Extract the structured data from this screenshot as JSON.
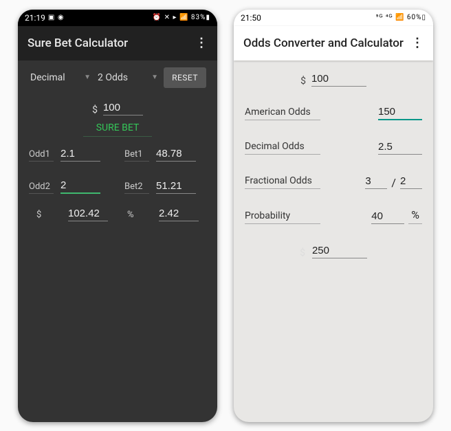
{
  "screen1": {
    "status_time": "21:19",
    "status_icons_left": "▣ ◉",
    "status_icons_right": "⏰ ✕ ▸ 📶 83%▮",
    "title": "Sure Bet Calculator",
    "dd1": "Decimal",
    "dd2": "2 Odds",
    "reset": "RESET",
    "currency": "$",
    "stake": "100",
    "surebet": "SURE BET",
    "odd1_label": "Odd1",
    "odd1_val": "2.1",
    "bet1_label": "Bet1",
    "bet1_val": "48.78",
    "odd2_label": "Odd2",
    "odd2_val": "2",
    "bet2_label": "Bet2",
    "bet2_val": "51.21",
    "total_money": "102.42",
    "percent_sym": "%",
    "total_pct": "2.42"
  },
  "screen2": {
    "status_time": "21:50",
    "status_icons_right": "⁵ᴳ ⁴ᴳ 📶 60%▯",
    "title": "Odds Converter and Calculator",
    "currency": "$",
    "stake": "100",
    "american_label": "American Odds",
    "american_val": "150",
    "decimal_label": "Decimal Odds",
    "decimal_val": "2.5",
    "fractional_label": "Fractional Odds",
    "frac_num": "3",
    "frac_sep": "/",
    "frac_den": "2",
    "probability_label": "Probability",
    "probability_val": "40",
    "pct_sym": "%",
    "result": "250"
  }
}
